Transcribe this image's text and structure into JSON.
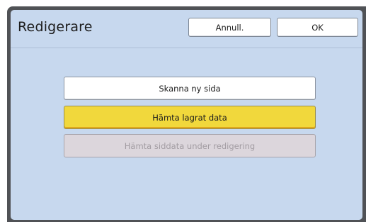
{
  "dialog": {
    "title": "Redigerare",
    "cancel_label": "Annull.",
    "ok_label": "OK"
  },
  "options": [
    {
      "label": "Skanna ny sida",
      "state": "normal"
    },
    {
      "label": "Hämta lagrat data",
      "state": "selected"
    },
    {
      "label": "Hämta siddata under redigering",
      "state": "disabled"
    }
  ],
  "colors": {
    "panel_background": "#c7d8ee",
    "selected_option": "#f1d83c",
    "disabled_option": "#dcd6dc",
    "frame": "#505256"
  }
}
